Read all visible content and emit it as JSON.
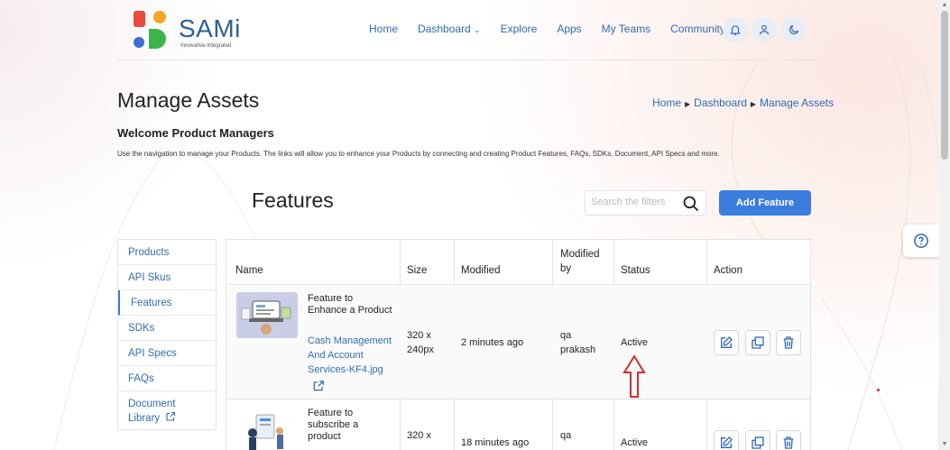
{
  "brand": {
    "name": "SAMi",
    "tagline": "Innovative-Integrated"
  },
  "nav": {
    "items": [
      "Home",
      "Dashboard",
      "Explore",
      "Apps",
      "My Teams",
      "Community"
    ]
  },
  "page": {
    "title": "Manage Assets",
    "breadcrumb": [
      "Home",
      "Dashboard",
      "Manage Assets"
    ],
    "welcome": "Welcome Product Managers",
    "intro": "Use the navigation to manage your Products. The links will allow you to enhance your Products by connecting and creating Product Features, FAQs, SDKs, Document, API Specs and more."
  },
  "section": {
    "title": "Features",
    "search_placeholder": "Search the filters",
    "add_button": "Add Feature"
  },
  "sidebar": {
    "items": [
      "Products",
      "API Skus",
      "Features",
      "SDKs",
      "API Specs",
      "FAQs",
      "Document Library"
    ],
    "active": "Features"
  },
  "table": {
    "headers": {
      "name": "Name",
      "size": "Size",
      "modified": "Modified",
      "modified_by": "Modified by",
      "status": "Status",
      "action": "Action"
    },
    "rows": [
      {
        "title": "Feature to Enhance a Product",
        "file": "Cash Management And Account Services-KF4.jpg",
        "size": "320 x 240px",
        "modified": "2 minutes ago",
        "modified_by": "qa prakash",
        "status": "Active"
      },
      {
        "title": "Feature to subscribe a product",
        "file": "",
        "size": "320 x",
        "modified": "18 minutes ago",
        "modified_by": "qa",
        "status": "Active"
      }
    ]
  },
  "colors": {
    "accent": "#3b7ddd",
    "link": "#2f6cb5",
    "annotation": "#d62d2d"
  }
}
